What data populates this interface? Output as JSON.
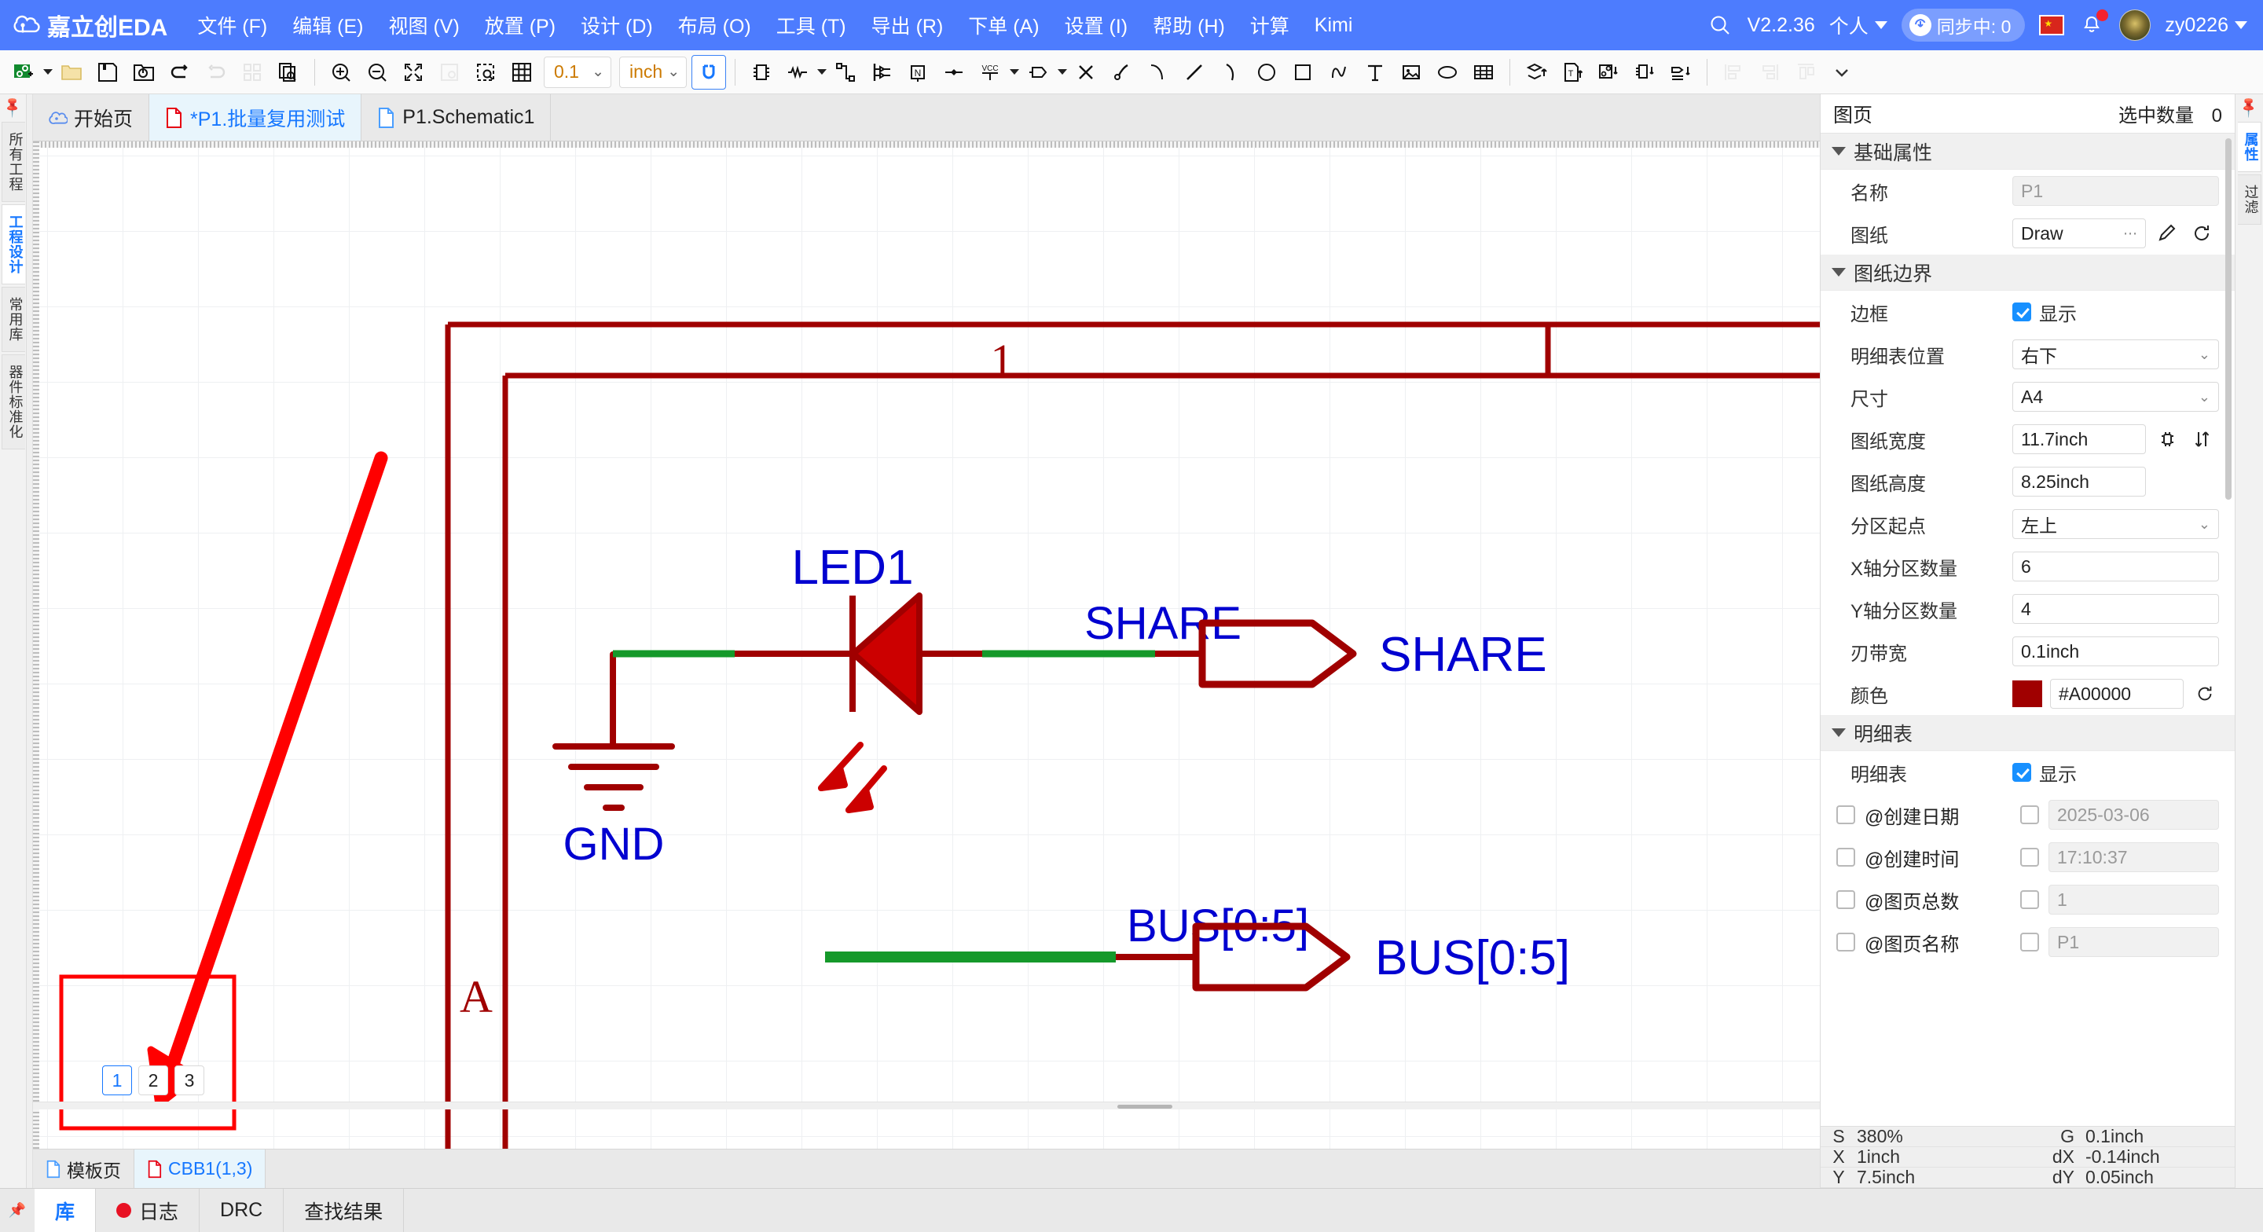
{
  "titlebar": {
    "brand": "嘉立创EDA",
    "menus": [
      "文件 (F)",
      "编辑 (E)",
      "视图 (V)",
      "放置 (P)",
      "设计 (D)",
      "布局 (O)",
      "工具 (T)",
      "导出 (R)",
      "下单 (A)",
      "设置 (I)",
      "帮助 (H)",
      "计算",
      "Kimi"
    ],
    "search_icon": "search-icon",
    "version": "V2.2.36",
    "account_type": "个人",
    "sync_label": "同步中: 0",
    "flag_icon": "china-flag-icon",
    "bell_icon": "notification-bell-icon",
    "username": "zy0226"
  },
  "toolbar": {
    "grid_value": "0.1",
    "unit_value": "inch",
    "icons": [
      "new-project-icon",
      "open-folder-icon",
      "save-icon",
      "save-as-icon",
      "undo-icon",
      "redo-icon",
      "grid-layout-icon",
      "page-search-icon",
      "zoom-in-icon",
      "zoom-out-icon",
      "fit-screen-icon",
      "zoom-area-icon",
      "select-area-icon",
      "grid-toggle-icon",
      "snap-magnet-icon",
      "component-icon",
      "resistor-icon",
      "wire-icon",
      "bus-entry-icon",
      "netlabel-icon",
      "junction-icon",
      "vcc-icon",
      "netport-icon",
      "no-connect-icon",
      "probe-icon",
      "arc-icon",
      "line-icon",
      "curve-icon",
      "circle-icon",
      "rect-icon",
      "spline-icon",
      "text-icon",
      "image-icon",
      "ellipse-icon",
      "table-icon",
      "flip-layer-icon",
      "update-text-icon",
      "update-symbol-icon",
      "update-component-icon",
      "update-netport-icon",
      "align-left-icon",
      "align-center-icon",
      "align-top-icon",
      "more-icon"
    ]
  },
  "left_rail": {
    "pin_icon": "pin-icon",
    "tabs": [
      "所有工程",
      "工程设计",
      "常用库",
      "器件标准化"
    ],
    "active_tab": "工程设计"
  },
  "doc_tabs": [
    {
      "label": "开始页",
      "icon": "home-cloud-icon",
      "active": false,
      "modified": false
    },
    {
      "label": "*P1.批量复用测试",
      "icon": "file-red-icon",
      "active": true,
      "modified": true
    },
    {
      "label": "P1.Schematic1",
      "icon": "file-blue-icon",
      "active": false,
      "modified": false
    }
  ],
  "canvas": {
    "zone_label_top": "1",
    "zone_label_left": "A",
    "component_designator": "LED1",
    "ground_label": "GND",
    "net_label_share": "SHARE",
    "port_label_share": "SHARE",
    "net_label_bus": "BUS[0:5]",
    "port_label_bus": "BUS[0:5]",
    "border_color": "#A00000",
    "wire_color": "#15992a",
    "label_color": "#0000d0",
    "annotation_color": "#ff0000",
    "page_buttons": [
      "1",
      "2",
      "3"
    ],
    "active_page_button": "1"
  },
  "page_tabs": [
    {
      "label": "模板页",
      "icon": "file-blue-icon",
      "active": false
    },
    {
      "label": "CBB1(1,3)",
      "icon": "file-red-icon",
      "active": true
    }
  ],
  "properties": {
    "title": "图页",
    "selected_count_label": "选中数量",
    "selected_count": "0",
    "basic_section": {
      "title": "基础属性",
      "rows": [
        {
          "label": "名称",
          "value": "P1",
          "readonly": true
        },
        {
          "label": "图纸",
          "value": "Draw",
          "display": "Draw",
          "edit_icon": "pencil-icon",
          "reset_icon": "refresh-icon"
        }
      ]
    },
    "border_section": {
      "title": "图纸边界",
      "border_label": "边框",
      "border_checked": true,
      "border_checkbox_label": "显示",
      "rows": [
        {
          "label": "明细表位置",
          "value": "右下",
          "type": "select"
        },
        {
          "label": "尺寸",
          "value": "A4",
          "type": "select"
        },
        {
          "label": "图纸宽度",
          "value": "11.7inch",
          "type": "input"
        },
        {
          "label": "图纸高度",
          "value": "8.25inch",
          "type": "input"
        },
        {
          "label": "分区起点",
          "value": "左上",
          "type": "select"
        },
        {
          "label": "X轴分区数量",
          "value": "6",
          "type": "input"
        },
        {
          "label": "Y轴分区数量",
          "value": "4",
          "type": "input"
        },
        {
          "label": "刃带宽",
          "value": "0.1inch",
          "type": "input"
        },
        {
          "label": "颜色",
          "value": "#A00000",
          "type": "color"
        }
      ]
    },
    "detail_section": {
      "title": "明细表",
      "show_label": "明细表",
      "show_checked": true,
      "show_checkbox_label": "显示",
      "rows": [
        {
          "label": "@创建日期",
          "value": "2025-03-06",
          "left_checked": false,
          "right_checked": false
        },
        {
          "label": "@创建时间",
          "value": "17:10:37",
          "left_checked": false,
          "right_checked": false
        },
        {
          "label": "@图页总数",
          "value": "1",
          "left_checked": false,
          "right_checked": false
        },
        {
          "label": "@图页名称",
          "value": "P1",
          "left_checked": false,
          "right_checked": false
        }
      ]
    }
  },
  "status": {
    "rows": [
      {
        "k": "S",
        "v": "380%",
        "k2": "G",
        "v2": "0.1inch"
      },
      {
        "k": "X",
        "v": "1inch",
        "k2": "dX",
        "v2": "-0.14inch"
      },
      {
        "k": "Y",
        "v": "7.5inch",
        "k2": "dY",
        "v2": "0.05inch"
      }
    ]
  },
  "right_rail": {
    "pin_icon": "pin-icon",
    "tabs": [
      "属性",
      "过滤"
    ],
    "active_tab": "属性"
  },
  "bottom_bar": {
    "pin_icon": "pin-icon",
    "tabs": [
      {
        "label": "库",
        "active": true,
        "dot": false
      },
      {
        "label": "日志",
        "active": false,
        "dot": true
      },
      {
        "label": "DRC",
        "active": false,
        "dot": false
      },
      {
        "label": "查找结果",
        "active": false,
        "dot": false
      }
    ]
  }
}
